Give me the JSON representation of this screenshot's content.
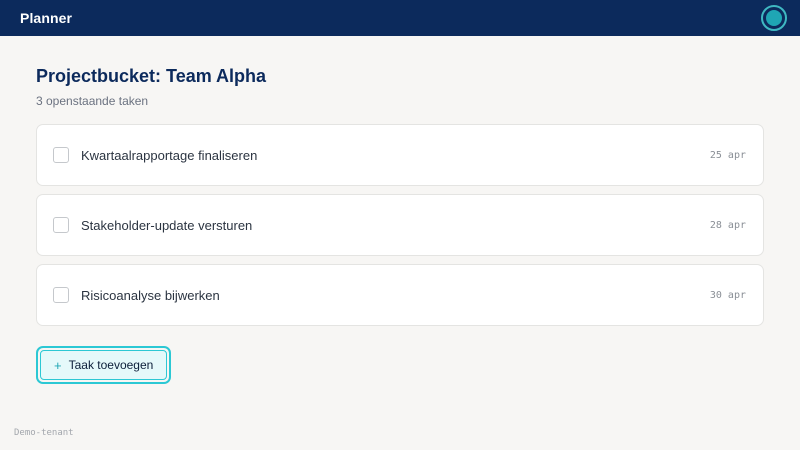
{
  "header": {
    "app_title": "Planner",
    "avatar_icon": "user-avatar-icon"
  },
  "main": {
    "title": "Projectbucket: Team Alpha",
    "subtitle": "3 openstaande taken",
    "tasks": [
      {
        "label": "Kwartaalrapportage finaliseren",
        "date": "25 apr",
        "checked": false
      },
      {
        "label": "Stakeholder-update versturen",
        "date": "28 apr",
        "checked": false
      },
      {
        "label": "Risicoanalyse bijwerken",
        "date": "30 apr",
        "checked": false
      }
    ],
    "add_button": {
      "icon": "+",
      "label": "Taak toevoegen"
    }
  },
  "footer": {
    "tenant": "Demo-tenant"
  },
  "colors": {
    "header_bg": "#0c2a5c",
    "accent": "#2cc8d4",
    "page_bg": "#f7f6f4"
  }
}
